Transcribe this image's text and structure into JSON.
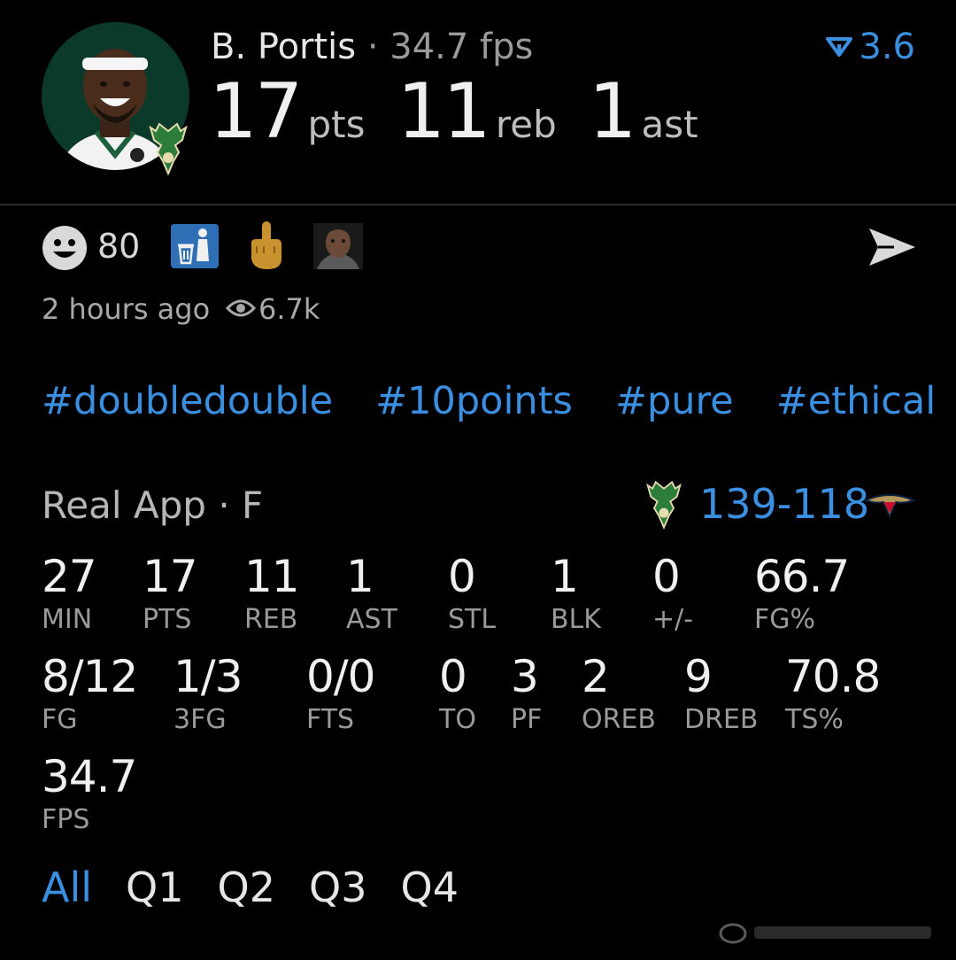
{
  "header": {
    "player_name": "B. Portis",
    "separator": "·",
    "fps": "34.7 fps",
    "fps_change": "3.6",
    "pts": "17",
    "pts_label": "pts",
    "reb": "11",
    "reb_label": "reb",
    "ast": "1",
    "ast_label": "ast"
  },
  "reactions": {
    "count": "80",
    "icons": [
      "smiley-icon",
      "trash-can-icon",
      "middle-finger-emoji",
      "face-emoji"
    ]
  },
  "meta": {
    "time": "2 hours ago",
    "views": "6.7k"
  },
  "hashtags": [
    "#doubledouble",
    "#10points",
    "#pure",
    "#ethical"
  ],
  "game": {
    "source": "Real App",
    "separator": "·",
    "status": "F",
    "score": "139-118"
  },
  "stats_row1": [
    {
      "value": "27",
      "label": "MIN"
    },
    {
      "value": "17",
      "label": "PTS"
    },
    {
      "value": "11",
      "label": "REB"
    },
    {
      "value": "1",
      "label": "AST"
    },
    {
      "value": "0",
      "label": "STL"
    },
    {
      "value": "1",
      "label": "BLK"
    },
    {
      "value": "0",
      "label": "+/-"
    },
    {
      "value": "66.7",
      "label": "FG%"
    }
  ],
  "stats_row2": [
    {
      "value": "8/12",
      "label": "FG"
    },
    {
      "value": "1/3",
      "label": "3FG"
    },
    {
      "value": "0/0",
      "label": "FTS"
    },
    {
      "value": "0",
      "label": "TO"
    },
    {
      "value": "3",
      "label": "PF"
    },
    {
      "value": "2",
      "label": "OREB"
    },
    {
      "value": "9",
      "label": "DREB"
    },
    {
      "value": "70.8",
      "label": "TS%"
    }
  ],
  "stats_row3": [
    {
      "value": "34.7",
      "label": "FPS"
    }
  ],
  "quarter_tabs": {
    "active": "All",
    "items": [
      "All",
      "Q1",
      "Q2",
      "Q3",
      "Q4"
    ]
  },
  "colors": {
    "accent": "#3b8fe0",
    "background": "#000000",
    "bucks_green": "#00471b"
  }
}
